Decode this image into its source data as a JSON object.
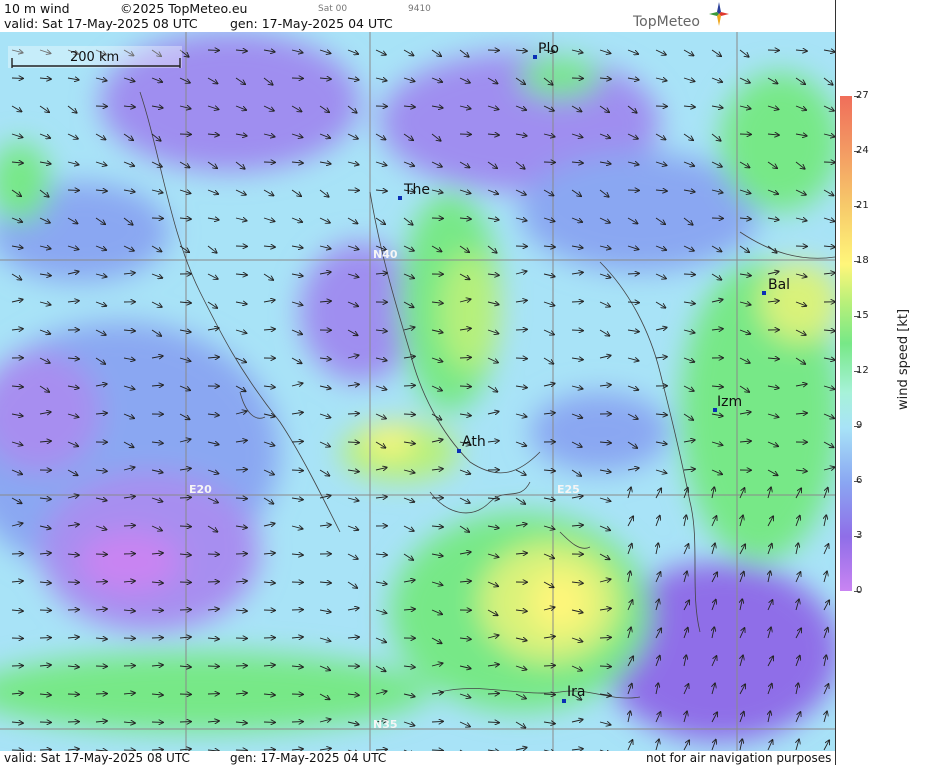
{
  "header": {
    "product": "10 m wind",
    "copyright": "©2025 TopMeteo.eu",
    "sat": "Sat 00",
    "code": "9410",
    "valid": "valid:  Sat  17-May-2025  08 UTC",
    "gen": "gen: 17-May-2025 04 UTC",
    "brand": "TopMeteo"
  },
  "footer": {
    "valid": "valid:  Sat  17-May-2025  08 UTC",
    "gen": "gen: 17-May-2025 04 UTC",
    "notice": "not for air navigation purposes"
  },
  "map": {
    "scale_label": "200 km",
    "cities": [
      {
        "label": "Plo"
      },
      {
        "label": "The"
      },
      {
        "label": "Bal"
      },
      {
        "label": "Izm"
      },
      {
        "label": "Ath"
      },
      {
        "label": "Ira"
      }
    ],
    "grid_labels": [
      "N40",
      "E20",
      "E25",
      "N35"
    ]
  },
  "legend": {
    "title": "wind speed [kt]",
    "ticks": [
      "27",
      "24",
      "21",
      "18",
      "15",
      "12",
      "9",
      "6",
      "3",
      "0"
    ],
    "colors": [
      "#f06e5a",
      "#f39a63",
      "#f7c96a",
      "#fff67a",
      "#b6f07a",
      "#77e887",
      "#a7f2d9",
      "#a8e3f7",
      "#8aa7f2",
      "#c984f2"
    ]
  }
}
